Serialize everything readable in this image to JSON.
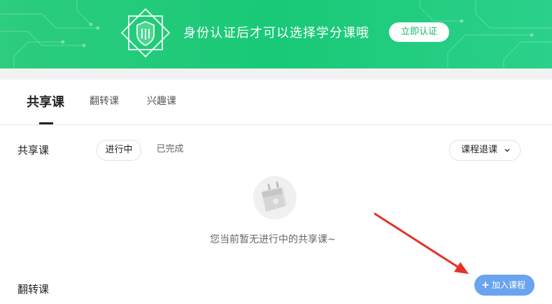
{
  "banner": {
    "text": "身份认证后才可以选择学分课哦",
    "verify_button": "立即认证"
  },
  "tabs": [
    {
      "label": "共享课",
      "active": true
    },
    {
      "label": "翻转课",
      "active": false
    },
    {
      "label": "兴趣课",
      "active": false
    }
  ],
  "shared_section": {
    "title": "共享课",
    "filters": [
      {
        "label": "进行中",
        "active": true
      },
      {
        "label": "已完成",
        "active": false
      }
    ],
    "withdraw_button": "课程退课",
    "empty_text": "您当前暂无进行中的共享课~"
  },
  "flip_section": {
    "title": "翻转课"
  },
  "join_button": "加入课程",
  "colors": {
    "banner_green": "#19c977",
    "join_blue": "#6aa4ee",
    "arrow_red": "#e5312a"
  }
}
